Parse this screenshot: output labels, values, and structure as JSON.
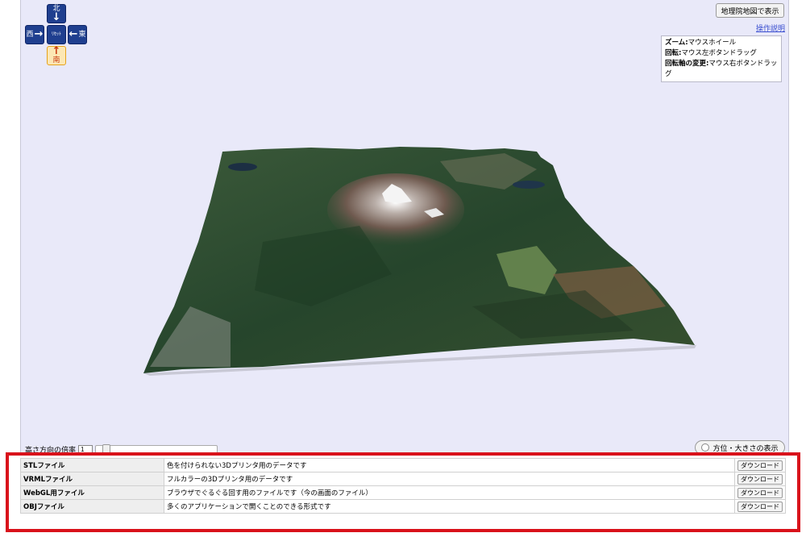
{
  "nav": {
    "north": "北",
    "west": "西",
    "reset": "ﾘｾｯﾄ",
    "east": "東",
    "south": "南"
  },
  "map_button": "地理院地図で表示",
  "help_link": "操作説明",
  "help": {
    "zoom_label": "ズーム:",
    "zoom_value": "マウスホイール",
    "rotate_label": "回転:",
    "rotate_value": "マウス左ボタンドラッグ",
    "axis_label": "回転軸の変更:",
    "axis_value": "マウス右ボタンドラッグ"
  },
  "scale": {
    "label": "高さ方向の倍率",
    "value": "1"
  },
  "direction_button": "方位・大きさの表示",
  "downloads": [
    {
      "type": "STLファイル",
      "desc": "色を付けられない3Dプリンタ用のデータです",
      "button": "ダウンロード"
    },
    {
      "type": "VRMLファイル",
      "desc": "フルカラーの3Dプリンタ用のデータです",
      "button": "ダウンロード"
    },
    {
      "type": "WebGL用ファイル",
      "desc": "ブラウザでぐるぐる回す用のファイルです（今の画面のファイル）",
      "button": "ダウンロード"
    },
    {
      "type": "OBJファイル",
      "desc": "多くのアプリケーションで開くことのできる形式です",
      "button": "ダウンロード"
    }
  ],
  "colors": {
    "viewer_bg": "#e9e9f9",
    "nav_blue": "#1f3f8f",
    "nav_active": "#fce7b4",
    "highlight_red": "#d9121b"
  }
}
